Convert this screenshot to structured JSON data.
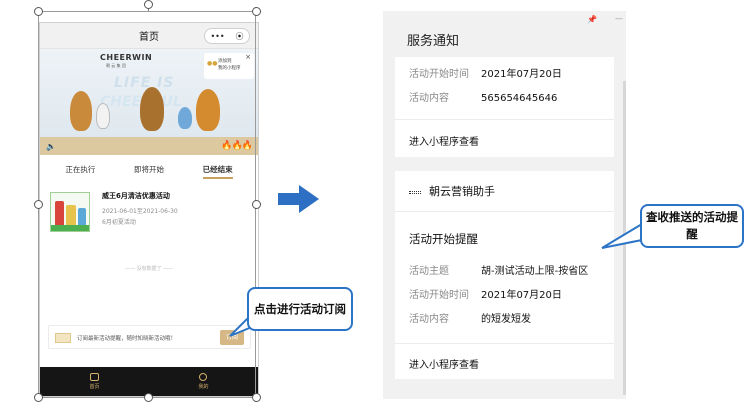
{
  "phone": {
    "title": "首页",
    "capsule_more": "•••",
    "capsule_close": "⦿",
    "brand": "CHEERWIN",
    "brand_sub": "朝 云 集 团",
    "slogan_line1": "LIFE IS",
    "slogan_line2": "CHEERFUL",
    "add_mini_line1": "添加到",
    "add_mini_line2": "我的小程序",
    "add_mini_close": "×",
    "sound_icon": "🔈",
    "fire": "🔥🔥🔥",
    "tabs": [
      {
        "label": "正在执行"
      },
      {
        "label": "即将开始"
      },
      {
        "label": "已经结束"
      }
    ],
    "activity": {
      "title": "威王6月清洁优惠活动",
      "date": "2021-06-01至2021-06-30",
      "subtitle": "6月初夏活动"
    },
    "no_more": "—— 没有数据了 ——",
    "subscribe_text": "订阅最新活动提醒，随时知晓新活动哦！",
    "subscribe_button": "订阅",
    "tabbar": [
      {
        "label": "首页"
      },
      {
        "label": "我的"
      }
    ]
  },
  "callouts": {
    "left": "点击进行活动订阅",
    "right": "查收推送的活动提醒"
  },
  "notifications": {
    "window_title": "服务通知",
    "pin": "📌",
    "minimize": "—",
    "card1": {
      "rows": [
        {
          "key": "活动开始时间",
          "value": "2021年07月20日"
        },
        {
          "key": "活动内容",
          "value": "565654645646"
        }
      ],
      "link": "进入小程序查看"
    },
    "card2": {
      "account": "朝云营销助手",
      "title": "活动开始提醒",
      "rows": [
        {
          "key": "活动主题",
          "value": "胡-测试活动上限-按省区"
        },
        {
          "key": "活动开始时间",
          "value": "2021年07月20日"
        },
        {
          "key": "活动内容",
          "value": "的短发短发"
        }
      ],
      "link": "进入小程序查看"
    }
  },
  "colors": {
    "accent_blue": "#2c74c6",
    "gold": "#d6b887",
    "tabbar_bg": "#151515"
  }
}
